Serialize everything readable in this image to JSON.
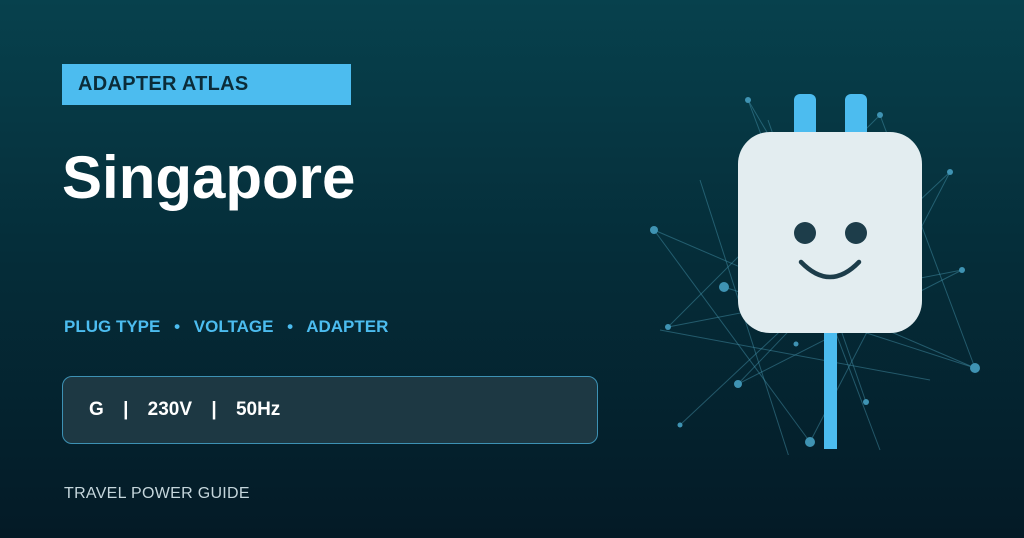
{
  "brand": {
    "badge_label": "ADAPTER ATLAS"
  },
  "page": {
    "title": "Singapore"
  },
  "features": [
    "PLUG TYPE",
    "VOLTAGE",
    "ADAPTER"
  ],
  "features_separator": "•",
  "specs": {
    "plug_type": "G",
    "voltage": "230V",
    "frequency": "50Hz",
    "separator": "|"
  },
  "footer": {
    "label": "TRAVEL POWER GUIDE"
  },
  "icons": {
    "illustration": "smiling-plug-icon"
  },
  "colors": {
    "accent": "#4cbcef",
    "plug_body": "#e3edf0",
    "face": "#1d3d4a",
    "background_top": "#07414d",
    "background_bottom": "#041a26"
  }
}
